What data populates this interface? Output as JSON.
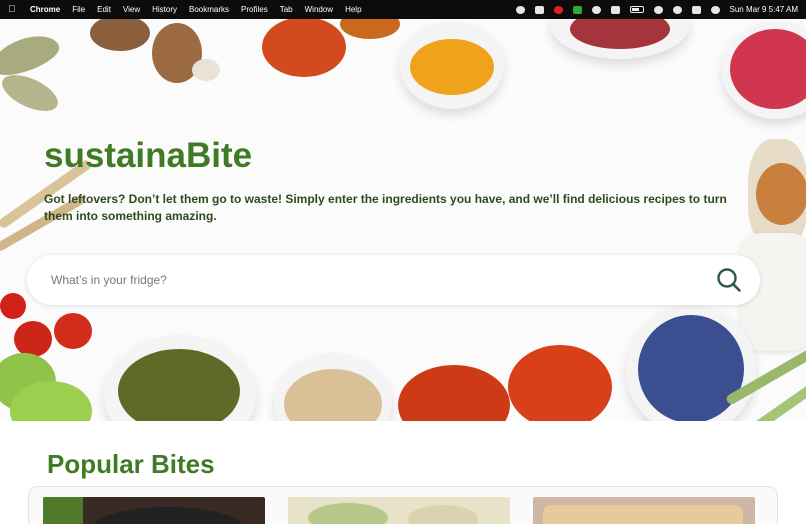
{
  "menubar": {
    "app_name": "Chrome",
    "items": [
      "File",
      "Edit",
      "View",
      "History",
      "Bookmarks",
      "Profiles",
      "Tab",
      "Window",
      "Help"
    ],
    "datetime": "Sun Mar 9  5:47 AM"
  },
  "hero": {
    "brand": "sustainaBite",
    "tagline": "Got leftovers? Don’t let them go to waste! Simply enter the ingredients you have, and we’ll find delicious recipes to turn them into something amazing.",
    "search_placeholder": "What’s in your fridge?"
  },
  "popular": {
    "title": "Popular Bites"
  },
  "colors": {
    "brand_green": "#3f7a25",
    "text_dark_green": "#2f4a1d"
  }
}
